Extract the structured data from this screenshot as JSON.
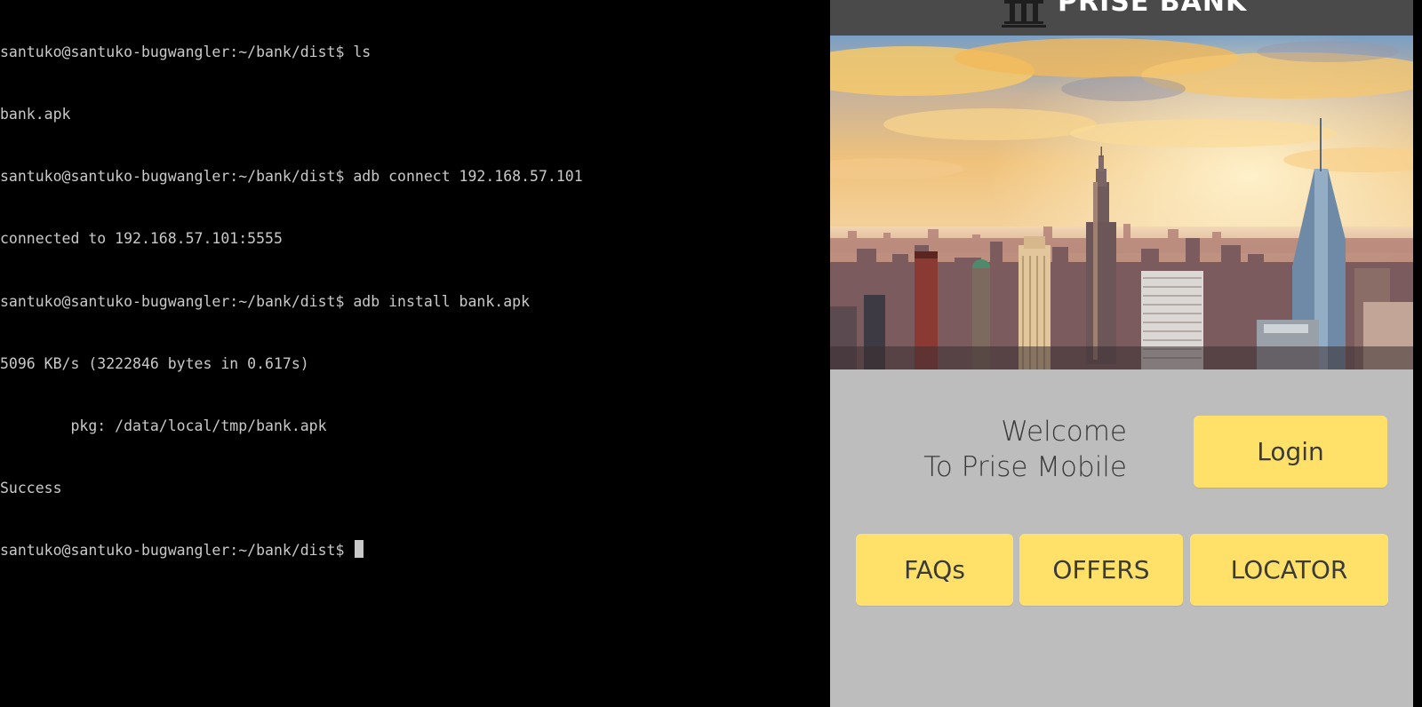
{
  "terminal": {
    "lines": [
      "santuko@santuko-bugwangler:~/bank/dist$ ls",
      "bank.apk",
      "santuko@santuko-bugwangler:~/bank/dist$ adb connect 192.168.57.101",
      "connected to 192.168.57.101:5555",
      "santuko@santuko-bugwangler:~/bank/dist$ adb install bank.apk",
      "5096 KB/s (3222846 bytes in 0.617s)",
      "        pkg: /data/local/tmp/bank.apk",
      "Success"
    ],
    "prompt": "santuko@santuko-bugwangler:~/bank/dist$ "
  },
  "app": {
    "title": "PRISE BANK",
    "logo_icon": "bank-building-icon",
    "hero_image": "city-skyline-image",
    "welcome_line1": "Welcome",
    "welcome_line2": "To Prise Mobile",
    "login_label": "Login",
    "faqs_label": "FAQs",
    "offers_label": "OFFERS",
    "locator_label": "LOCATOR"
  },
  "colors": {
    "terminal_bg": "#000000",
    "terminal_fg": "#c9c9c9",
    "header_bg": "#4a4a4a",
    "app_bg": "#bdbdbd",
    "button_yellow": "#ffe16a",
    "button_text": "#3a3a3a"
  }
}
